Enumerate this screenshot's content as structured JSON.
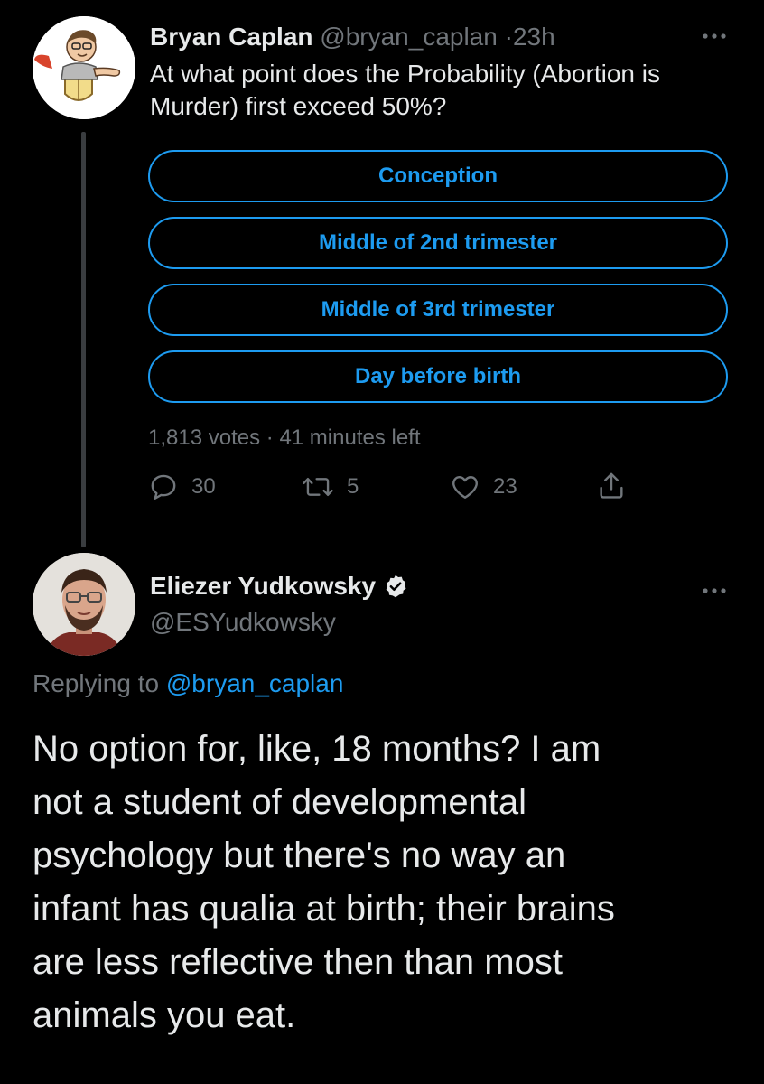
{
  "colors": {
    "background": "#000000",
    "text_primary": "#e7e9ea",
    "text_secondary": "#71767b",
    "accent": "#1d9bf0",
    "thread_line": "#3a3d40"
  },
  "tweet1": {
    "author_name": "Bryan Caplan",
    "handle": "@bryan_caplan",
    "separator": "·",
    "time": "23h",
    "text": "At what point does the Probability (Abortion is Murder) first exceed 50%?",
    "poll": {
      "options": [
        "Conception",
        "Middle of 2nd trimester",
        "Middle of 3rd trimester",
        "Day before birth"
      ],
      "votes": "1,813 votes",
      "meta_separator": "·",
      "time_left": "41 minutes left"
    },
    "actions": {
      "replies": "30",
      "retweets": "5",
      "likes": "23"
    },
    "icons": [
      "reply-icon",
      "retweet-icon",
      "like-icon",
      "share-icon",
      "more-icon"
    ]
  },
  "tweet2": {
    "author_name": "Eliezer Yudkowsky",
    "handle": "@ESYudkowsky",
    "replying_prefix": "Replying to",
    "replying_handle": "@bryan_caplan",
    "text": "No option for, like, 18 months?  I am\nnot a student of developmental\npsychology but there's no way an\ninfant has qualia at birth; their brains\nare less reflective then than most\nanimals you eat.",
    "icons": [
      "verified-badge-icon",
      "more-icon"
    ]
  }
}
